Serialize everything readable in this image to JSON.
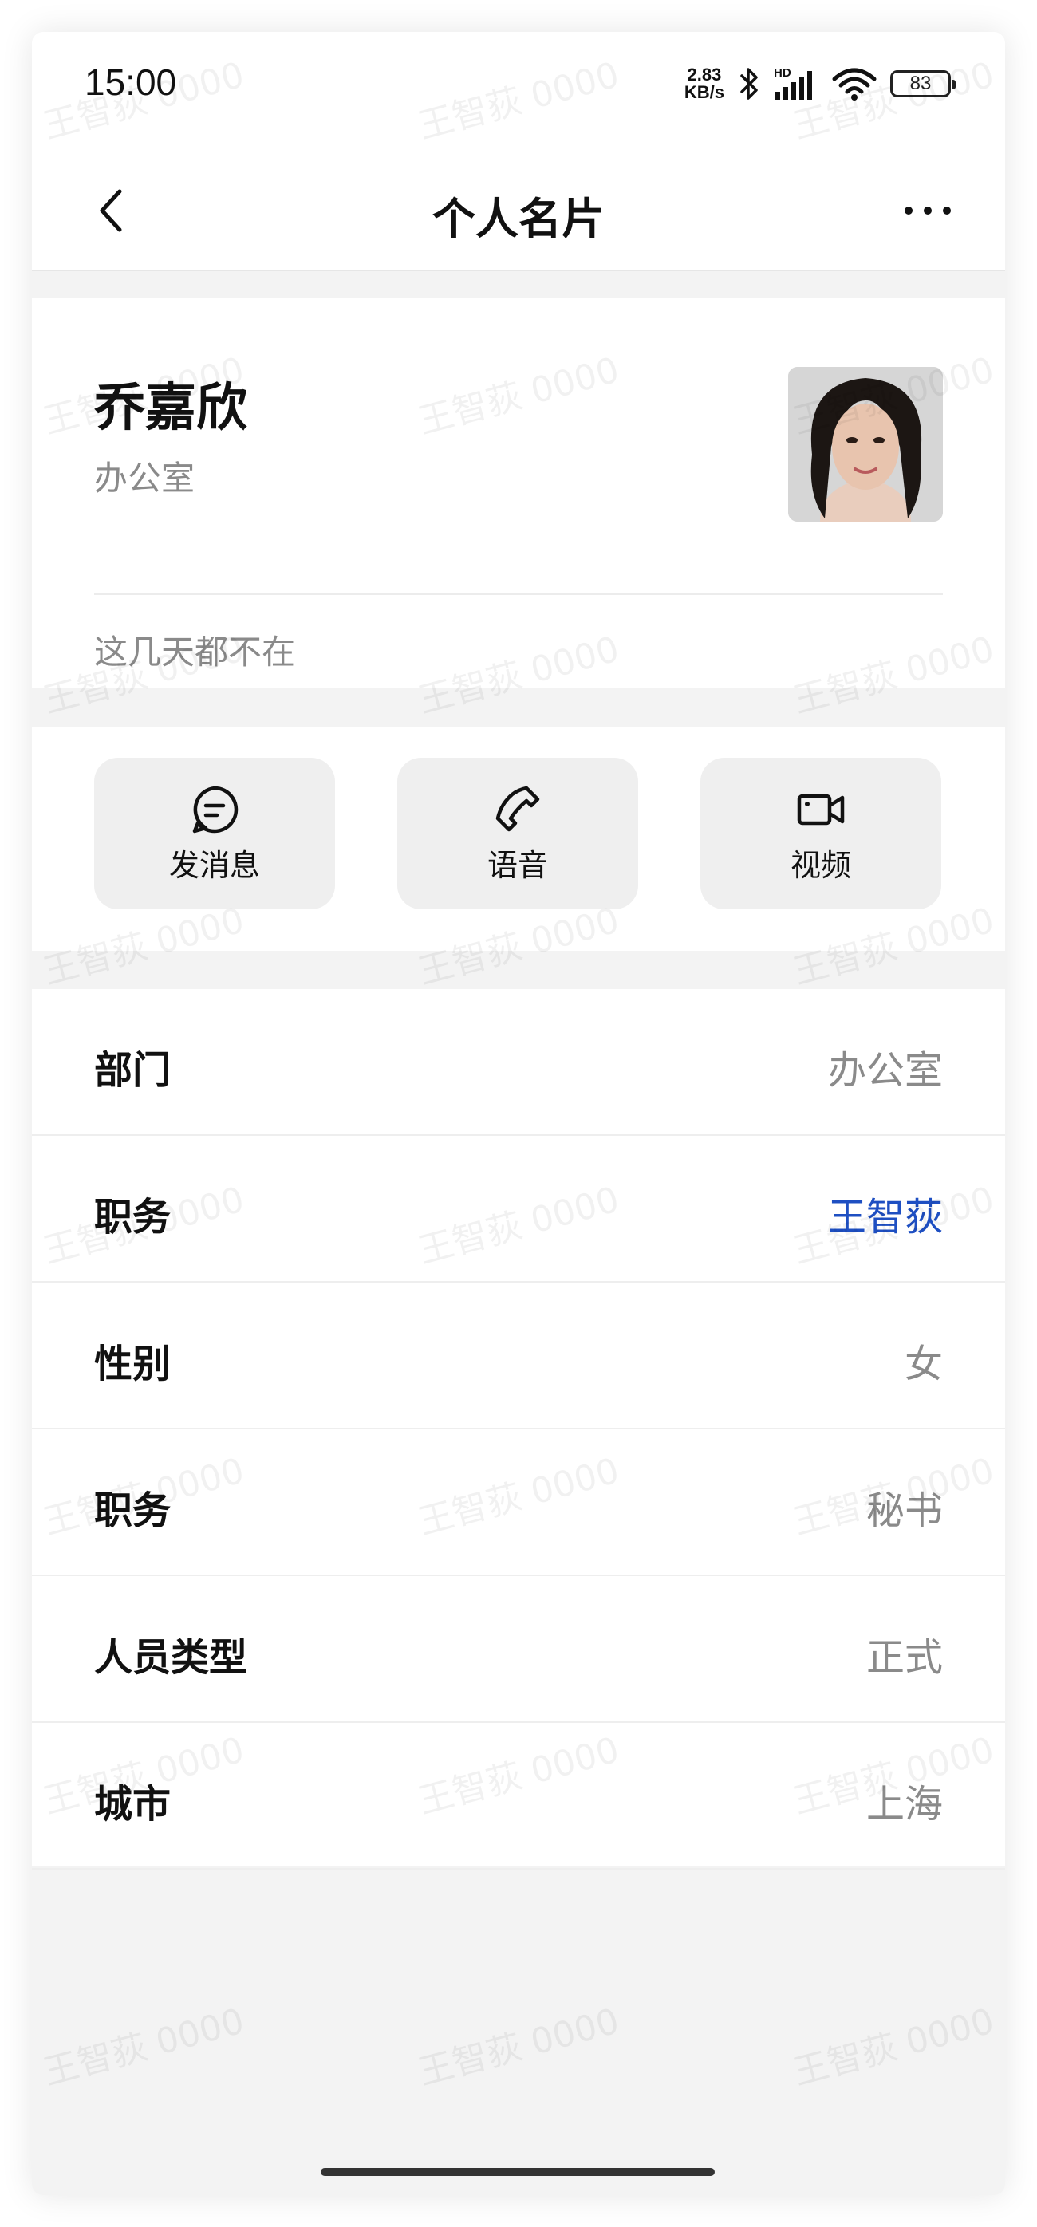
{
  "status_bar": {
    "time": "15:00",
    "net_speed_value": "2.83",
    "net_speed_unit": "KB/s",
    "hd_label": "HD",
    "battery": "83"
  },
  "nav": {
    "title": "个人名片",
    "back_icon": "chevron-left-icon",
    "more_icon": "more-horizontal-icon"
  },
  "profile": {
    "name": "乔嘉欣",
    "department": "办公室",
    "signature": "这几天都不在"
  },
  "actions": [
    {
      "label": "发消息",
      "icon": "message-icon"
    },
    {
      "label": "语音",
      "icon": "phone-icon"
    },
    {
      "label": "视频",
      "icon": "video-icon"
    }
  ],
  "info_rows": [
    {
      "key": "部门",
      "value": "办公室"
    },
    {
      "key": "职务",
      "value": "王智荻"
    },
    {
      "key": "性别",
      "value": "女"
    },
    {
      "key": "职务",
      "value": "秘书"
    },
    {
      "key": "人员类型",
      "value": "正式"
    },
    {
      "key": "城市",
      "value": "上海"
    }
  ],
  "watermark": "王智荻 0000",
  "colors": {
    "link": "#1e4fc2",
    "secondary_text": "#8a8a8a",
    "background": "#f3f3f3"
  }
}
